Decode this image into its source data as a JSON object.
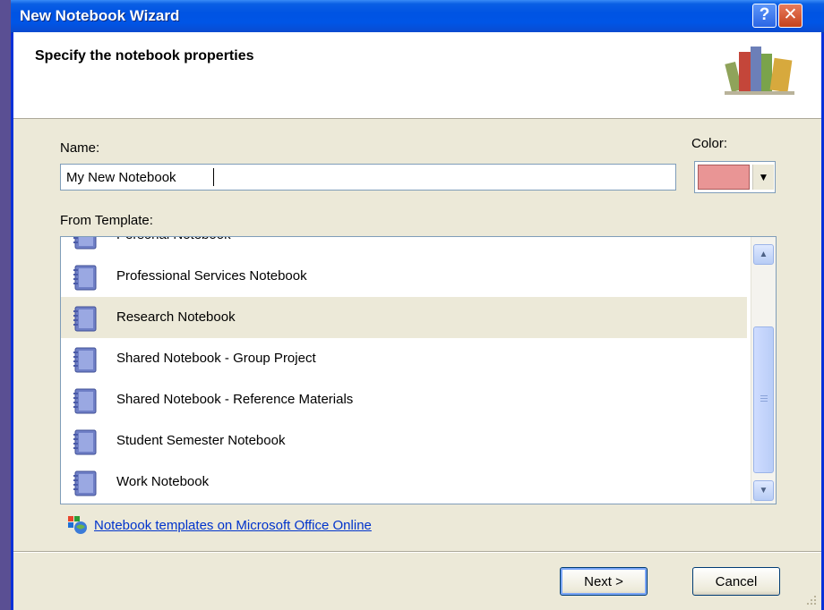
{
  "window": {
    "title": "New Notebook Wizard"
  },
  "header": {
    "title": "Specify the notebook properties"
  },
  "name_field": {
    "label": "Name:",
    "value": "My New Notebook"
  },
  "color_field": {
    "label": "Color:",
    "selected_color": "#e99595"
  },
  "template_list": {
    "label": "From Template:",
    "items": [
      {
        "label": "Personal Notebook"
      },
      {
        "label": "Professional Services Notebook"
      },
      {
        "label": "Research Notebook",
        "selected": true
      },
      {
        "label": "Shared Notebook - Group Project"
      },
      {
        "label": "Shared Notebook - Reference Materials"
      },
      {
        "label": "Student Semester Notebook"
      },
      {
        "label": "Work Notebook"
      }
    ]
  },
  "online_link": {
    "text": "Notebook templates on Microsoft Office Online"
  },
  "buttons": {
    "next": "Next >",
    "cancel": "Cancel"
  },
  "titlebar_buttons": {
    "help": "?",
    "close": "✕"
  },
  "colors": {
    "titlebar": "#0054e3",
    "dialog_bg": "#ece9d8",
    "link": "#0033cc"
  }
}
